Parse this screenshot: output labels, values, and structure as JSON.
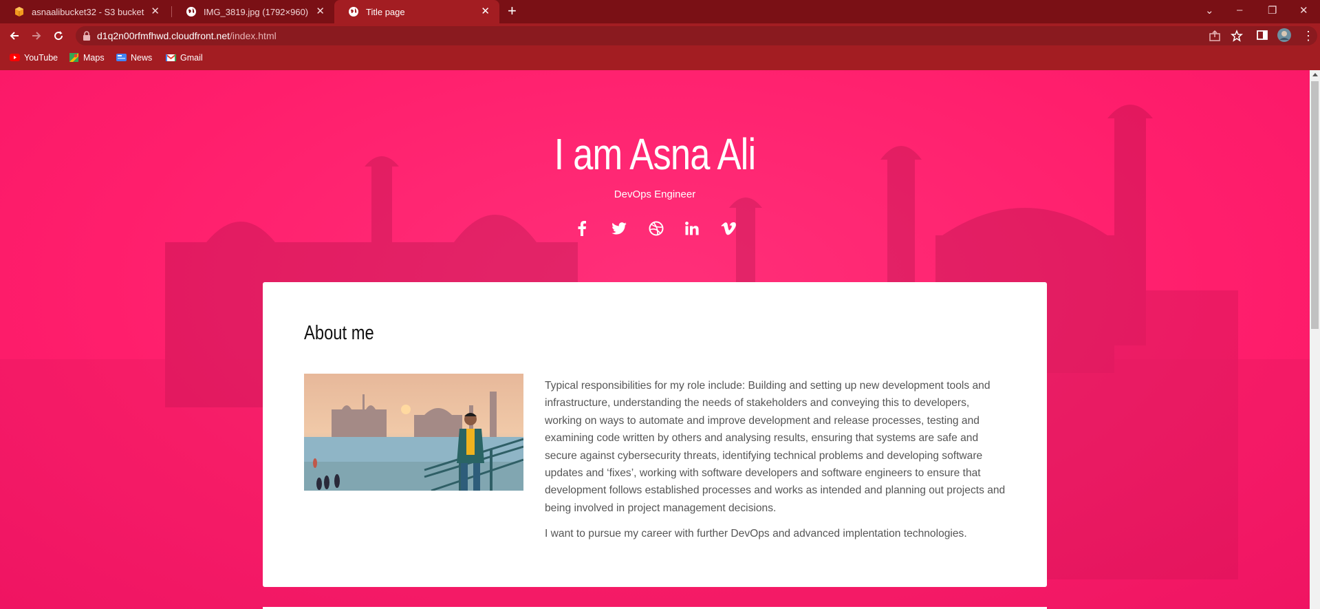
{
  "browser": {
    "tabs": [
      {
        "title": "asnaalibucket32 - S3 bucket",
        "icon": "aws-s3-icon",
        "active": false
      },
      {
        "title": "IMG_3819.jpg (1792×960)",
        "icon": "globe-icon",
        "active": false
      },
      {
        "title": "Title page",
        "icon": "globe-icon",
        "active": true
      }
    ],
    "new_tab_label": "+",
    "address": {
      "host": "d1q2n00rfmfhwd.cloudfront.net",
      "path": "/index.html"
    },
    "bookmarks": [
      {
        "label": "YouTube",
        "icon": "youtube-icon"
      },
      {
        "label": "Maps",
        "icon": "maps-icon"
      },
      {
        "label": "News",
        "icon": "news-icon"
      },
      {
        "label": "Gmail",
        "icon": "gmail-icon"
      }
    ],
    "colors": {
      "tabbar": "#7a1015",
      "toolbar": "#a31d22"
    }
  },
  "hero": {
    "title": "I am Asna Ali",
    "subtitle": "DevOps Engineer",
    "socials": [
      "facebook-icon",
      "twitter-icon",
      "dribbble-icon",
      "linkedin-icon",
      "vimeo-icon"
    ],
    "background_color": "#ff2170"
  },
  "about": {
    "heading": "About me",
    "paragraphs": [
      "Typical responsibilities for my role include: Building and setting up new development tools and infrastructure, understanding the needs of stakeholders and conveying this to developers, working on ways to automate and improve development and release processes, testing and examining code written by others and analysing results, ensuring that systems are safe and secure against cybersecurity threats, identifying technical problems and developing software updates and ‘fixes’, working with software developers and software engineers to ensure that development follows established processes and works as intended and planning out projects and being involved in project management decisions.",
      "I want to pursue my career with further DevOps and advanced implentation technologies."
    ]
  }
}
